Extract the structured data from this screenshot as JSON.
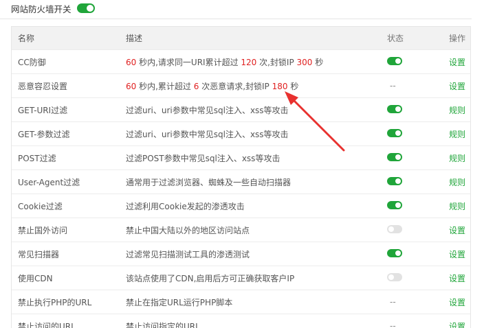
{
  "header": {
    "label": "网站防火墙开关",
    "enabled": true
  },
  "table": {
    "columns": {
      "name": "名称",
      "desc": "描述",
      "status": "状态",
      "op": "操作"
    },
    "rows": [
      {
        "name": "CC防御",
        "desc_parts": [
          {
            "t": "60",
            "num": true
          },
          {
            "t": " 秒内,请求同一URI累计超过 "
          },
          {
            "t": "120",
            "num": true
          },
          {
            "t": " 次,封锁IP "
          },
          {
            "t": "300",
            "num": true
          },
          {
            "t": " 秒"
          }
        ],
        "status": "on",
        "op": "设置"
      },
      {
        "name": "恶意容忍设置",
        "desc_parts": [
          {
            "t": "60",
            "num": true
          },
          {
            "t": " 秒内,累计超过 "
          },
          {
            "t": "6",
            "num": true
          },
          {
            "t": " 次恶意请求,封锁IP "
          },
          {
            "t": "180",
            "num": true
          },
          {
            "t": " 秒"
          }
        ],
        "status": "--",
        "op": "设置"
      },
      {
        "name": "GET-URI过滤",
        "desc": "过滤uri、uri参数中常见sql注入、xss等攻击",
        "status": "on",
        "op": "规则"
      },
      {
        "name": "GET-参数过滤",
        "desc": "过滤uri、uri参数中常见sql注入、xss等攻击",
        "status": "on",
        "op": "规则"
      },
      {
        "name": "POST过滤",
        "desc": "过滤POST参数中常见sql注入、xss等攻击",
        "status": "on",
        "op": "规则"
      },
      {
        "name": "User-Agent过滤",
        "desc": "通常用于过滤浏览器、蜘蛛及一些自动扫描器",
        "status": "on",
        "op": "规则"
      },
      {
        "name": "Cookie过滤",
        "desc": "过滤利用Cookie发起的渗透攻击",
        "status": "on",
        "op": "规则"
      },
      {
        "name": "禁止国外访问",
        "desc": "禁止中国大陆以外的地区访问站点",
        "status": "off",
        "op": "设置"
      },
      {
        "name": "常见扫描器",
        "desc": "过滤常见扫描测试工具的渗透测试",
        "status": "on",
        "op": "设置"
      },
      {
        "name": "使用CDN",
        "desc": "该站点使用了CDN,启用后方可正确获取客户IP",
        "status": "off",
        "op": "设置"
      },
      {
        "name": "禁止执行PHP的URL",
        "desc": "禁止在指定URL运行PHP脚本",
        "status": "--",
        "op": "设置"
      },
      {
        "name": "禁止访问的URL",
        "desc": "禁止访问指定的URL",
        "status": "--",
        "op": "设置"
      }
    ]
  },
  "colors": {
    "accent": "#20a53a",
    "highlight": "#e02020",
    "annotation_arrow": "#e8312f"
  }
}
